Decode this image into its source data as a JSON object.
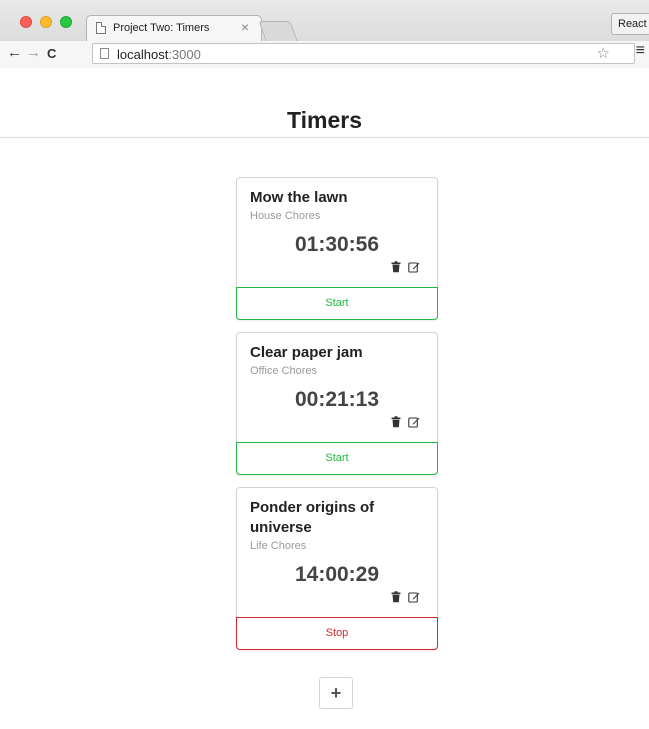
{
  "browser": {
    "tab_title": "Project Two: Timers",
    "tab_close": "×",
    "profile_label": "React",
    "url_host": "localhost",
    "url_port": ":3000",
    "nav": {
      "back": "←",
      "forward": "→",
      "reload": "C"
    },
    "star": "☆",
    "menu": "≡"
  },
  "page": {
    "title": "Timers"
  },
  "timers": [
    {
      "title": "Mow the lawn",
      "project": "House Chores",
      "elapsed": "01:30:56",
      "button": "Start",
      "running": false
    },
    {
      "title": "Clear paper jam",
      "project": "Office Chores",
      "elapsed": "00:21:13",
      "button": "Start",
      "running": false
    },
    {
      "title": "Ponder origins of universe",
      "project": "Life Chores",
      "elapsed": "14:00:29",
      "button": "Stop",
      "running": true
    }
  ],
  "add_button": {
    "label": "+"
  },
  "colors": {
    "start": "#21ba45",
    "stop": "#db2828"
  },
  "icons": {
    "delete": "trash-icon",
    "edit": "edit-icon"
  }
}
